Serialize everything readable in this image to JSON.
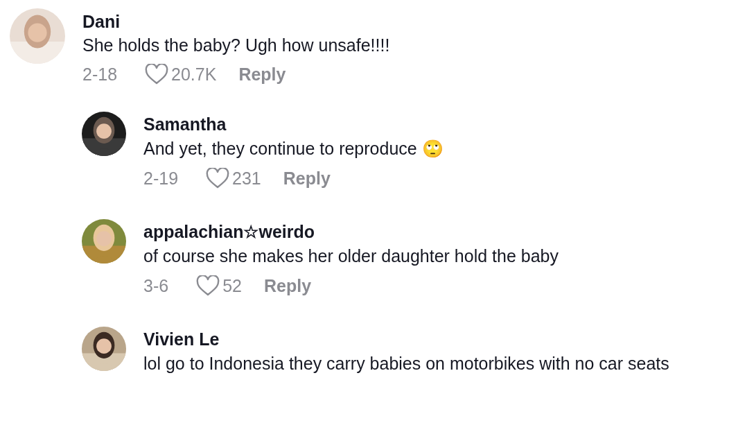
{
  "comments": [
    {
      "author": "Dani",
      "text": "She holds the baby? Ugh how unsafe!!!!",
      "date": "2-18",
      "likes": "20.7K",
      "reply": "Reply",
      "children": [
        {
          "author": "Samantha",
          "text": "And yet, they continue to reproduce 🙄",
          "date": "2-19",
          "likes": "231",
          "reply": "Reply"
        },
        {
          "author": "appalachian☆weirdo",
          "text": "of course she makes her older daughter hold the baby",
          "date": "3-6",
          "likes": "52",
          "reply": "Reply"
        },
        {
          "author": "Vivien Le",
          "text": "lol go to Indonesia they carry babies on motorbikes with no car seats"
        }
      ]
    }
  ]
}
